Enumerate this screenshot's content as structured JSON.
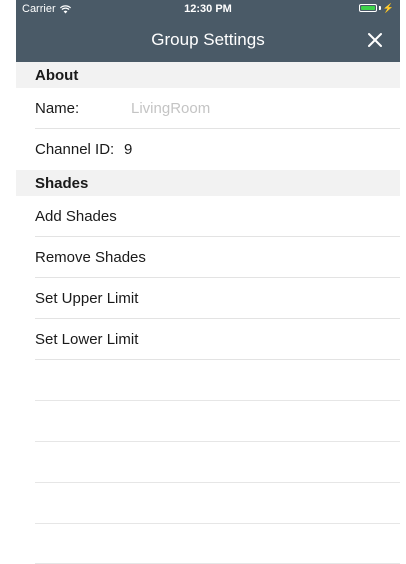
{
  "status_bar": {
    "carrier": "Carrier",
    "time": "12:30 PM",
    "battery_color": "#3dd34a"
  },
  "nav": {
    "title": "Group Settings",
    "background": "#4a5a67"
  },
  "sections": {
    "about": {
      "header": "About",
      "name_label": "Name:",
      "name_placeholder": "LivingRoom",
      "name_value": "",
      "channel_label": "Channel ID:",
      "channel_value": "9"
    },
    "shades": {
      "header": "Shades",
      "actions": [
        {
          "label": "Add Shades"
        },
        {
          "label": "Remove Shades"
        },
        {
          "label": "Set Upper Limit"
        },
        {
          "label": "Set Lower Limit"
        }
      ]
    }
  }
}
